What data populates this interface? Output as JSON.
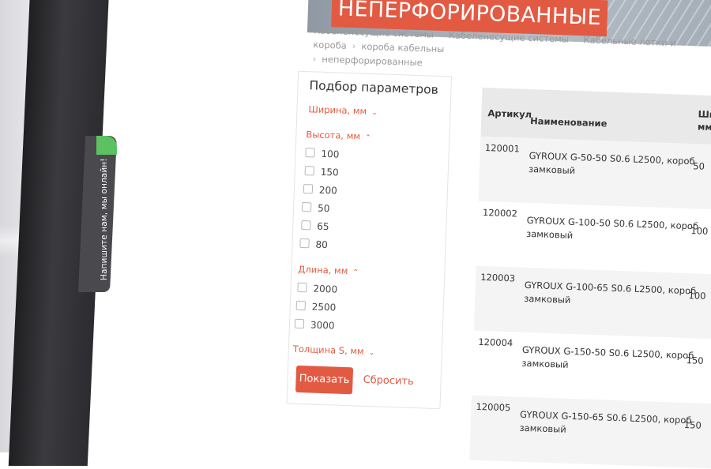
{
  "chat": {
    "label": "Напишите нам, мы онлайн!"
  },
  "banner": {
    "title": "НЕПЕРФОРИРОВАННЫЕ"
  },
  "breadcrumb": [
    "Кабеленесущие системы",
    "Кабеленесущие системы",
    "Кабельные лотки и короба",
    "короба кабельны",
    "неперфорированные"
  ],
  "filter": {
    "title": "Подбор параметров",
    "groups": [
      {
        "label": "Ширина, мм",
        "chevron": "⌄",
        "options": []
      },
      {
        "label": "Высота, мм",
        "chevron": "⌃",
        "options": [
          "100",
          "150",
          "200",
          "50",
          "65",
          "80"
        ]
      },
      {
        "label": "Длина, мм",
        "chevron": "⌃",
        "options": [
          "2000",
          "2500",
          "3000"
        ]
      },
      {
        "label": "Толщина S, мм",
        "chevron": "⌄",
        "options": []
      }
    ],
    "show_label": "Показать",
    "reset_label": "Сбросить"
  },
  "table": {
    "headers": {
      "sku": "Артикул",
      "name": "Наименование",
      "width_line1": "Шир",
      "width_line2": "мм"
    },
    "rows": [
      {
        "sku": "120001",
        "name1": "GYROUX G-50-50 S0.6 L2500, короб",
        "name2": "замковый",
        "width": "50"
      },
      {
        "sku": "120002",
        "name1": "GYROUX G-100-50 S0.6 L2500, короб",
        "name2": "замковый",
        "width": "100"
      },
      {
        "sku": "120003",
        "name1": "GYROUX G-100-65 S0.6 L2500, короб",
        "name2": "замковый",
        "width": "100"
      },
      {
        "sku": "120004",
        "name1": "GYROUX G-150-50 S0.6 L2500, короб",
        "name2": "замковый",
        "width": "150"
      },
      {
        "sku": "120005",
        "name1": "GYROUX G-150-65 S0.6 L2500, короб",
        "name2": "замковый",
        "width": "150"
      }
    ]
  },
  "colors": {
    "accent": "#e35a43",
    "online": "#5cc261",
    "header_bg": "#e9e9e9"
  }
}
